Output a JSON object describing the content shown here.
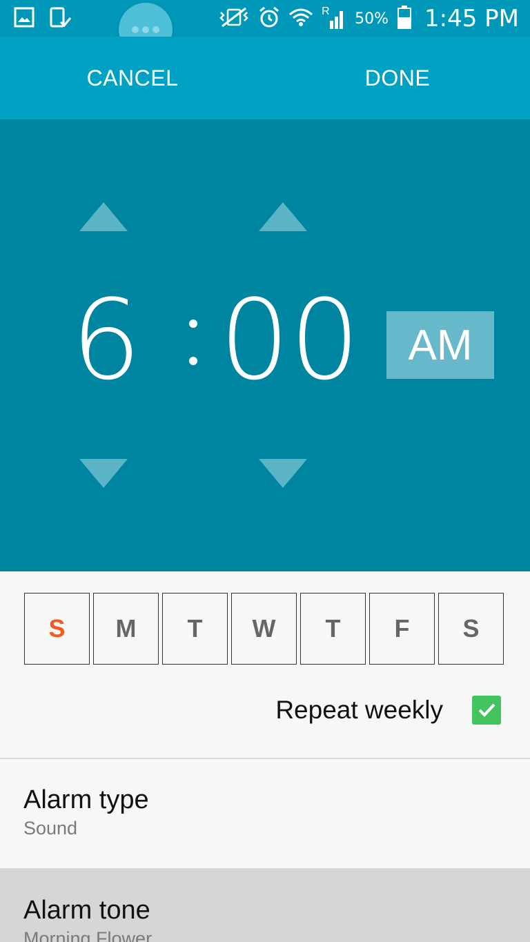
{
  "status_bar": {
    "left_icons": [
      "gallery-icon",
      "screen-mirror-icon"
    ],
    "right_icons": [
      "vibrate-icon",
      "alarm-clock-icon",
      "wifi-icon",
      "signal-icon",
      "battery-icon"
    ],
    "roaming": "R",
    "battery": "50%",
    "time": "1:45 PM"
  },
  "action_bar": {
    "cancel_label": "CANCEL",
    "done_label": "DONE"
  },
  "time_picker": {
    "hour": "6",
    "minute": "00",
    "separator": ":",
    "period": "AM"
  },
  "days": [
    {
      "label": "S",
      "active": true
    },
    {
      "label": "M",
      "active": false
    },
    {
      "label": "T",
      "active": false
    },
    {
      "label": "W",
      "active": false
    },
    {
      "label": "T",
      "active": false
    },
    {
      "label": "F",
      "active": false
    },
    {
      "label": "S",
      "active": false
    }
  ],
  "repeat": {
    "label": "Repeat weekly",
    "checked": true
  },
  "settings": {
    "alarm_type": {
      "title": "Alarm type",
      "value": "Sound"
    },
    "alarm_tone": {
      "title": "Alarm tone",
      "value": "Morning Flower"
    }
  },
  "colors": {
    "accent": "#00a1c2",
    "picker_bg": "#0085a0",
    "active_day": "#f25a1f",
    "checkbox": "#43c45f"
  }
}
